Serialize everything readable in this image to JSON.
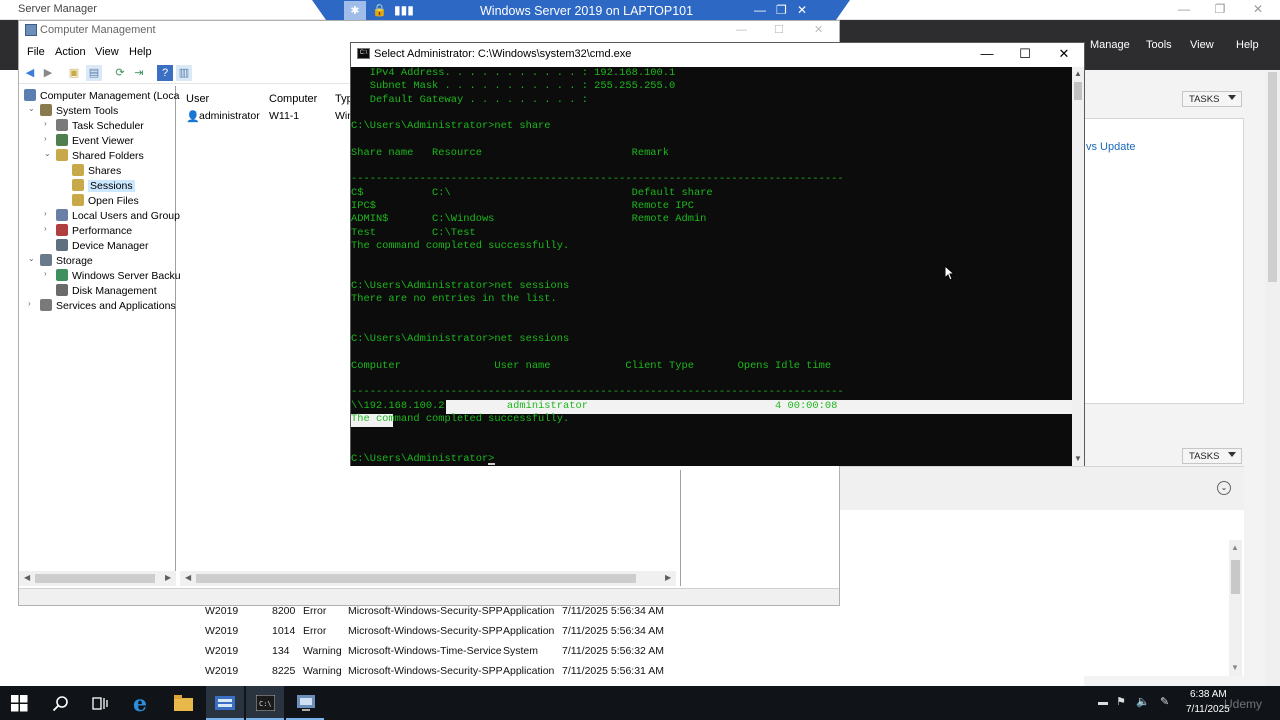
{
  "vm_bar": {
    "title": "Windows Server 2019 on LAPTOP101"
  },
  "server_manager": {
    "title": "Server Manager",
    "menus": [
      "Manage",
      "Tools",
      "View",
      "Help"
    ],
    "tasks_label": "TASKS",
    "update_link": "vs Update",
    "events": [
      {
        "server": "W2019",
        "id": "8200",
        "severity": "Error",
        "source": "Microsoft-Windows-Security-SPP",
        "log": "Application",
        "time": "7/11/2025 5:56:34 AM"
      },
      {
        "server": "W2019",
        "id": "1014",
        "severity": "Error",
        "source": "Microsoft-Windows-Security-SPP",
        "log": "Application",
        "time": "7/11/2025 5:56:34 AM"
      },
      {
        "server": "W2019",
        "id": "134",
        "severity": "Warning",
        "source": "Microsoft-Windows-Time-Service",
        "log": "System",
        "time": "7/11/2025 5:56:32 AM"
      },
      {
        "server": "W2019",
        "id": "8225",
        "severity": "Warning",
        "source": "Microsoft-Windows-Security-SPP",
        "log": "Application",
        "time": "7/11/2025 5:56:31 AM"
      }
    ]
  },
  "computer_management": {
    "title": "Computer Management",
    "menus": [
      "File",
      "Action",
      "View",
      "Help"
    ],
    "tree": [
      {
        "label": "Computer Management (Local)",
        "level": 0,
        "expander": "",
        "icon": "computer-icon",
        "color": "#5a7fb0"
      },
      {
        "label": "System Tools",
        "level": 1,
        "expander": "⌄",
        "icon": "tools-icon",
        "color": "#8a7a50"
      },
      {
        "label": "Task Scheduler",
        "level": 2,
        "expander": "›",
        "icon": "clock-icon",
        "color": "#7a7a7a"
      },
      {
        "label": "Event Viewer",
        "level": 2,
        "expander": "›",
        "icon": "event-viewer-icon",
        "color": "#4f7f4f"
      },
      {
        "label": "Shared Folders",
        "level": 2,
        "expander": "⌄",
        "icon": "shared-folder-icon",
        "color": "#c8a94a"
      },
      {
        "label": "Shares",
        "level": 3,
        "expander": "",
        "icon": "shares-icon",
        "color": "#c8a94a"
      },
      {
        "label": "Sessions",
        "level": 3,
        "expander": "",
        "icon": "sessions-icon",
        "color": "#c8a94a",
        "selected": true
      },
      {
        "label": "Open Files",
        "level": 3,
        "expander": "",
        "icon": "open-files-icon",
        "color": "#c8a94a"
      },
      {
        "label": "Local Users and Groups",
        "level": 2,
        "expander": "›",
        "icon": "users-icon",
        "color": "#6a7fa8"
      },
      {
        "label": "Performance",
        "level": 2,
        "expander": "›",
        "icon": "performance-icon",
        "color": "#b04040"
      },
      {
        "label": "Device Manager",
        "level": 2,
        "expander": "",
        "icon": "device-manager-icon",
        "color": "#5f6f7f"
      },
      {
        "label": "Storage",
        "level": 1,
        "expander": "⌄",
        "icon": "storage-icon",
        "color": "#6a7a8a"
      },
      {
        "label": "Windows Server Backup",
        "level": 2,
        "expander": "›",
        "icon": "backup-icon",
        "color": "#3f8f5f"
      },
      {
        "label": "Disk Management",
        "level": 2,
        "expander": "",
        "icon": "disk-icon",
        "color": "#6a6a6a"
      },
      {
        "label": "Services and Applications",
        "level": 1,
        "expander": "›",
        "icon": "services-icon",
        "color": "#7a7a7a"
      }
    ],
    "columns": [
      "User",
      "Computer",
      "Typ"
    ],
    "sessions": [
      {
        "user": "administrator",
        "computer": "W11-1",
        "type": "Win"
      }
    ]
  },
  "cmd": {
    "title": "Select Administrator: C:\\Windows\\system32\\cmd.exe",
    "lines": [
      "   IPv4 Address. . . . . . . . . . . : 192.168.100.1",
      "   Subnet Mask . . . . . . . . . . . : 255.255.255.0",
      "   Default Gateway . . . . . . . . . :",
      "",
      "C:\\Users\\Administrator>net share",
      "",
      "Share name   Resource                        Remark",
      "",
      "-------------------------------------------------------------------------------",
      "C$           C:\\                             Default share",
      "IPC$                                         Remote IPC",
      "ADMIN$       C:\\Windows                      Remote Admin",
      "Test         C:\\Test",
      "The command completed successfully.",
      "",
      "",
      "C:\\Users\\Administrator>net sessions",
      "There are no entries in the list.",
      "",
      "",
      "C:\\Users\\Administrator>net sessions",
      "",
      "Computer               User name            Client Type       Opens Idle time",
      "",
      "-------------------------------------------------------------------------------",
      "\\\\192.168.100.2          administrator                              4 00:00:08",
      "The command completed successfully.",
      "",
      "",
      "C:\\Users\\Administrator>"
    ]
  },
  "taskbar": {
    "time": "6:38 AM",
    "date": "7/11/2025",
    "watermark": "Udemy"
  }
}
